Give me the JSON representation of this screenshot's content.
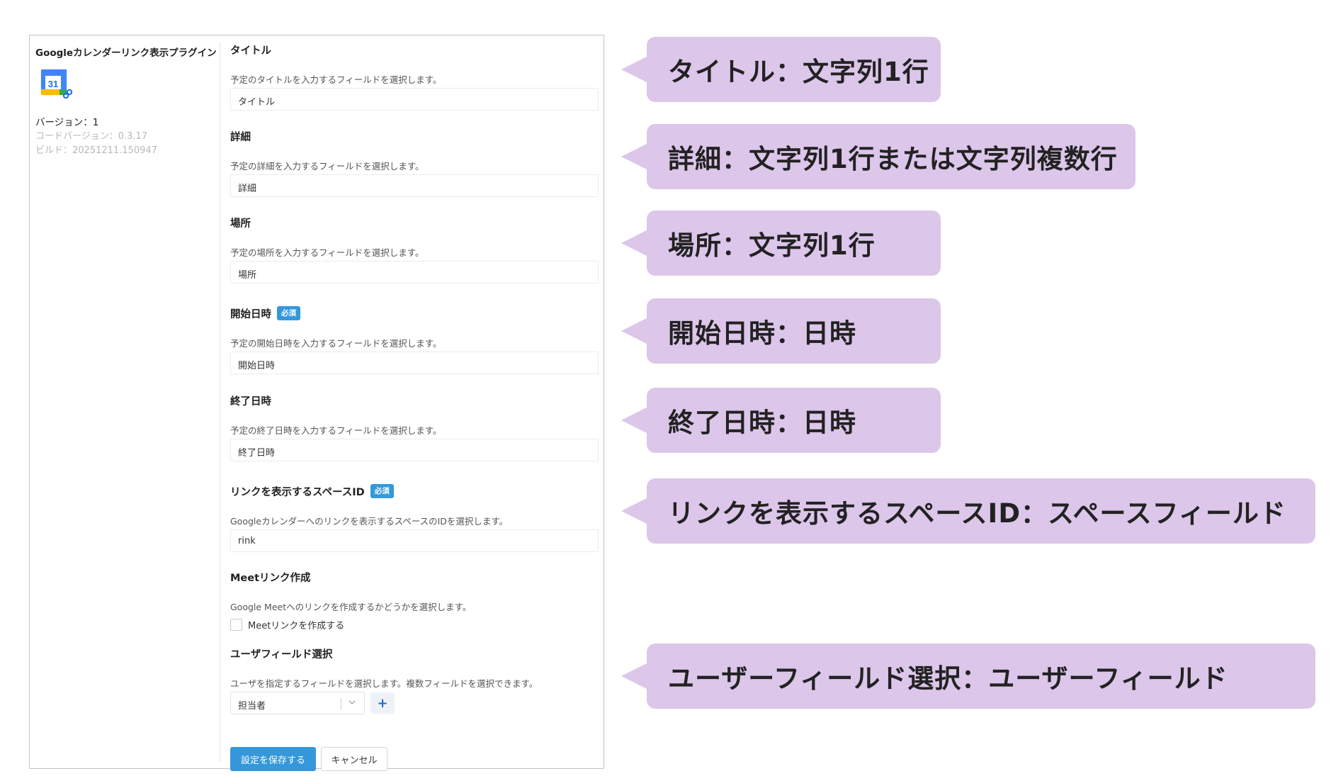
{
  "plugin": {
    "title": "Googleカレンダーリンク表示プラグイン",
    "version": "バージョン：1",
    "code_version": "コードバージョン：0.3.17",
    "build": "ビルド：20251211.150947",
    "logo_number": "31"
  },
  "fields": [
    {
      "label": "タイトル",
      "desc": "予定のタイトルを入力するフィールドを選択します。",
      "value": "タイトル"
    },
    {
      "label": "詳細",
      "desc": "予定の詳細を入力するフィールドを選択します。",
      "value": "詳細"
    },
    {
      "label": "場所",
      "desc": "予定の場所を入力するフィールドを選択します。",
      "value": "場所"
    },
    {
      "label": "開始日時",
      "badge": "必須",
      "desc": "予定の開始日時を入力するフィールドを選択します。",
      "value": "開始日時"
    },
    {
      "label": "終了日時",
      "desc": "予定の終了日時を入力するフィールドを選択します。",
      "value": "終了日時"
    },
    {
      "label": "リンクを表示するスペースID",
      "badge": "必須",
      "desc": "Googleカレンダーへのリンクを表示するスペースのIDを選択します。",
      "value": "rink"
    }
  ],
  "meet": {
    "label": "Meetリンク作成",
    "desc": "Google Meetへのリンクを作成するかどうかを選択します。",
    "checkbox_label": "Meetリンクを作成する",
    "checked": false
  },
  "user_field": {
    "label": "ユーザフィールド選択",
    "desc": "ユーザを指定するフィールドを選択します。複数フィールドを選択できます。",
    "selected": "担当者",
    "add_label": "+"
  },
  "buttons": {
    "save": "設定を保存する",
    "cancel": "キャンセル"
  },
  "callouts": [
    "タイトル：文字列1行",
    "詳細：文字列1行または文字列複数行",
    "場所：文字列1行",
    "開始日時：日時",
    "終了日時：日時",
    "リンクを表示するスペースID：スペースフィールド",
    "ユーザーフィールド選択：ユーザーフィールド"
  ],
  "colors": {
    "accent": "#3498db",
    "callout_bg": "#dcc6ea"
  }
}
